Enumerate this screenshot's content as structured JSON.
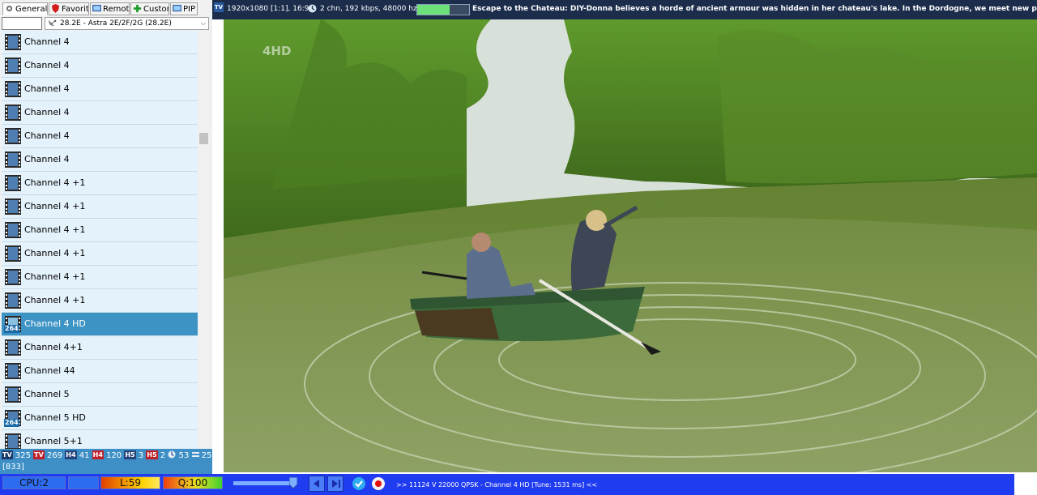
{
  "tabs": [
    {
      "label": "General",
      "icon": "gear-icon"
    },
    {
      "label": "Favorit...",
      "icon": "shield-icon"
    },
    {
      "label": "Remote",
      "icon": "tv-icon"
    },
    {
      "label": "Custom",
      "icon": "plus-icon"
    },
    {
      "label": "PIP",
      "icon": "tv-icon"
    }
  ],
  "filter": {
    "value": ""
  },
  "satellite": {
    "selected": "28.2E -  Astra 2E/2F/2G (28.2E)"
  },
  "channels": [
    {
      "name": "Channel 4",
      "badge": ""
    },
    {
      "name": "Channel 4",
      "badge": ""
    },
    {
      "name": "Channel 4",
      "badge": ""
    },
    {
      "name": "Channel 4",
      "badge": ""
    },
    {
      "name": "Channel 4",
      "badge": ""
    },
    {
      "name": "Channel 4",
      "badge": ""
    },
    {
      "name": "Channel 4 +1",
      "badge": ""
    },
    {
      "name": "Channel 4 +1",
      "badge": ""
    },
    {
      "name": "Channel 4 +1",
      "badge": ""
    },
    {
      "name": "Channel 4 +1",
      "badge": ""
    },
    {
      "name": "Channel 4 +1",
      "badge": ""
    },
    {
      "name": "Channel 4 +1",
      "badge": ""
    },
    {
      "name": "Channel 4 HD",
      "badge": "264",
      "selected": true
    },
    {
      "name": "Channel 4+1",
      "badge": ""
    },
    {
      "name": "Channel 44",
      "badge": ""
    },
    {
      "name": "Channel 5",
      "badge": ""
    },
    {
      "name": "Channel 5 HD",
      "badge": "264"
    },
    {
      "name": "Channel 5+1",
      "badge": ""
    }
  ],
  "stats": {
    "tv_count": "325",
    "tv_enc": "269",
    "h4": "41",
    "h4_enc": "120",
    "h5": "3",
    "h5_enc": "2",
    "radio": "53",
    "other": "25",
    "total": "[833]",
    "tv_lbl": "TV",
    "h4_lbl": "H4",
    "h5_lbl": "H5"
  },
  "infobar": {
    "tv_label": "TV",
    "resolution": "1920x1080 [1:1], 16:9",
    "audio": "2 chn, 192 kbps, 48000 hz",
    "signal_level": 0.62,
    "epg": "Escape to the Chateau: DIY-Donna believes a horde of ancient armour was hidden in her chateau's lake. In the Dordogne, we meet new parents Tim and Krys. And Colette"
  },
  "video": {
    "logo": "4HD"
  },
  "bottombar": {
    "cpu": "CPU:2",
    "level": "L:59",
    "quality": "Q:100",
    "status": ">> 11124 V 22000 QPSK - Channel 4 HD [Tune: 1531 ms] <<"
  },
  "colors": {
    "accent": "#3d94c4",
    "bottombar": "#1f3cf0",
    "infobar": "#1c2d4c",
    "signal": "#6ee07a"
  }
}
